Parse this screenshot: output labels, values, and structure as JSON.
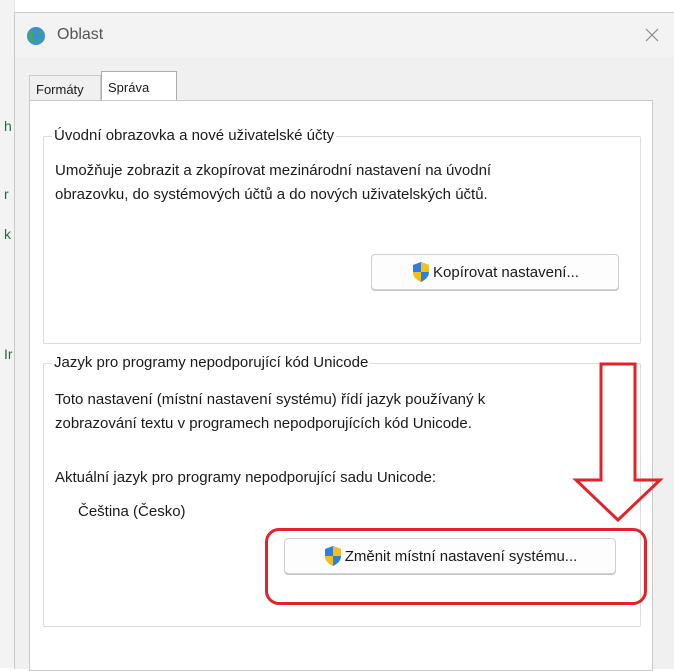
{
  "window": {
    "title": "Oblast",
    "close_glyph": "✕"
  },
  "tabs": [
    {
      "label": "Formáty",
      "active": false
    },
    {
      "label": "Správa",
      "active": true
    }
  ],
  "group1": {
    "title": "Úvodní obrazovka a nové uživatelské účty",
    "description_line1": "Umožňuje zobrazit a zkopírovat mezinárodní nastavení na úvodní",
    "description_line2": "obrazovku, do systémových účtů a do nových uživatelských účtů.",
    "button_label": "Kopírovat nastavení..."
  },
  "group2": {
    "title": "Jazyk pro programy nepodporující kód Unicode",
    "description_line1": "Toto nastavení (místní nastavení systému) řídí jazyk používaný k",
    "description_line2": "zobrazování textu v programech nepodporujících kód Unicode.",
    "current_label": "Aktuální jazyk pro programy nepodporující sadu Unicode:",
    "current_value": "Čeština (Česko)",
    "button_label": "Změnit místní nastavení systému..."
  },
  "colors": {
    "highlight": "#e3232b",
    "shield_blue": "#2f7ed8",
    "shield_yellow": "#f4c01e"
  }
}
